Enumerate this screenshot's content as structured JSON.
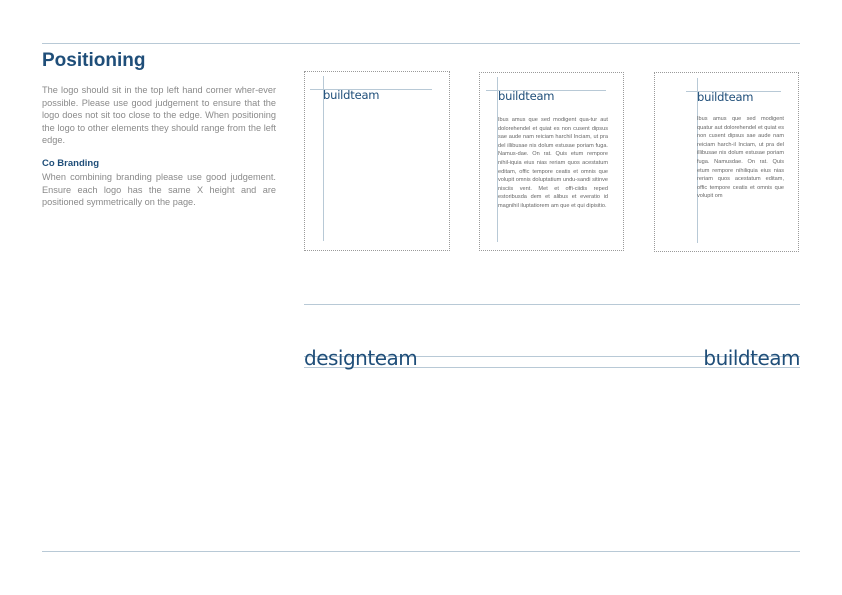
{
  "page": {
    "title": "Positioning",
    "intro": "The logo should sit in the top left hand corner wher-ever possible. Please use good judgement to ensure that the logo does not sit too close to the edge. When positioning the logo to other elements they should range from the left edge.",
    "cobranding_heading": "Co Branding",
    "cobranding_text": "When combining branding please use good judgement. Ensure each logo has the same X height and are positioned symmetrically on the page."
  },
  "examples": {
    "logo": "buildteam",
    "sample_text_2": "Ibus amus que sed modigent qua-tur aut dolorehendel et quiat es non cusent dipsus sae aude nam reiciam harchil Inciam, ut pra del illibusae nis dolum estusae poriam fuga. Namus-dae. On rat. Quis etum rempore nihil-iquia eius nias reriam quos acestatum editam, offic tempore ceatis et omnis que volupit omnis doluptatium undu-sandi sitinve nisciis vent. Met et offi-ciidis reped estoribusda dem et alibus et everatio id magnihil iluptatiorem am que et qui dipisitio.",
    "sample_text_3": "Ibus amus que sed modigent quatur aut dolorehendel et quiat es non cusent dipsus sae aude nam reiciam harch-il Inciam, ut pra del illibusae nis dolum estusae poriam fuga. Namusdae. On rat. Quis etum rempore nihiliquia eius nias reriam quos acestatum editam, offic tempore ceatis et omnis que volupit om"
  },
  "cobrand": {
    "left_logo": "designteam",
    "right_logo": "buildteam"
  },
  "colors": {
    "brand": "#1f4e79",
    "guide": "#b8c9d6",
    "body_text": "#8a8a8a"
  }
}
